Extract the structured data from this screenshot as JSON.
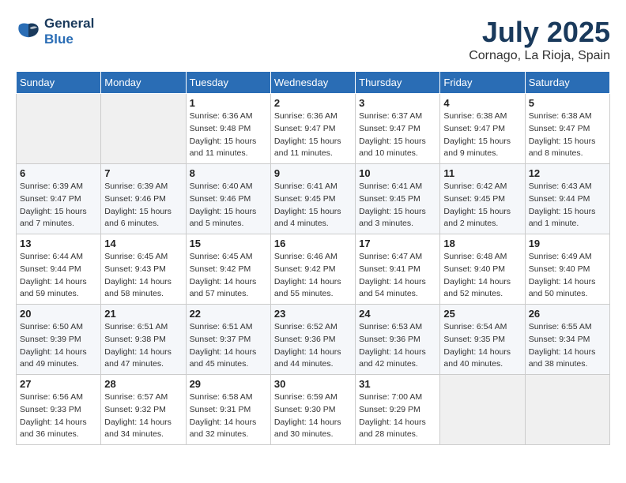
{
  "logo": {
    "line1": "General",
    "line2": "Blue"
  },
  "title": "July 2025",
  "location": "Cornago, La Rioja, Spain",
  "weekdays": [
    "Sunday",
    "Monday",
    "Tuesday",
    "Wednesday",
    "Thursday",
    "Friday",
    "Saturday"
  ],
  "weeks": [
    [
      {
        "day": "",
        "sunrise": "",
        "sunset": "",
        "daylight": ""
      },
      {
        "day": "",
        "sunrise": "",
        "sunset": "",
        "daylight": ""
      },
      {
        "day": "1",
        "sunrise": "Sunrise: 6:36 AM",
        "sunset": "Sunset: 9:48 PM",
        "daylight": "Daylight: 15 hours and 11 minutes."
      },
      {
        "day": "2",
        "sunrise": "Sunrise: 6:36 AM",
        "sunset": "Sunset: 9:47 PM",
        "daylight": "Daylight: 15 hours and 11 minutes."
      },
      {
        "day": "3",
        "sunrise": "Sunrise: 6:37 AM",
        "sunset": "Sunset: 9:47 PM",
        "daylight": "Daylight: 15 hours and 10 minutes."
      },
      {
        "day": "4",
        "sunrise": "Sunrise: 6:38 AM",
        "sunset": "Sunset: 9:47 PM",
        "daylight": "Daylight: 15 hours and 9 minutes."
      },
      {
        "day": "5",
        "sunrise": "Sunrise: 6:38 AM",
        "sunset": "Sunset: 9:47 PM",
        "daylight": "Daylight: 15 hours and 8 minutes."
      }
    ],
    [
      {
        "day": "6",
        "sunrise": "Sunrise: 6:39 AM",
        "sunset": "Sunset: 9:47 PM",
        "daylight": "Daylight: 15 hours and 7 minutes."
      },
      {
        "day": "7",
        "sunrise": "Sunrise: 6:39 AM",
        "sunset": "Sunset: 9:46 PM",
        "daylight": "Daylight: 15 hours and 6 minutes."
      },
      {
        "day": "8",
        "sunrise": "Sunrise: 6:40 AM",
        "sunset": "Sunset: 9:46 PM",
        "daylight": "Daylight: 15 hours and 5 minutes."
      },
      {
        "day": "9",
        "sunrise": "Sunrise: 6:41 AM",
        "sunset": "Sunset: 9:45 PM",
        "daylight": "Daylight: 15 hours and 4 minutes."
      },
      {
        "day": "10",
        "sunrise": "Sunrise: 6:41 AM",
        "sunset": "Sunset: 9:45 PM",
        "daylight": "Daylight: 15 hours and 3 minutes."
      },
      {
        "day": "11",
        "sunrise": "Sunrise: 6:42 AM",
        "sunset": "Sunset: 9:45 PM",
        "daylight": "Daylight: 15 hours and 2 minutes."
      },
      {
        "day": "12",
        "sunrise": "Sunrise: 6:43 AM",
        "sunset": "Sunset: 9:44 PM",
        "daylight": "Daylight: 15 hours and 1 minute."
      }
    ],
    [
      {
        "day": "13",
        "sunrise": "Sunrise: 6:44 AM",
        "sunset": "Sunset: 9:44 PM",
        "daylight": "Daylight: 14 hours and 59 minutes."
      },
      {
        "day": "14",
        "sunrise": "Sunrise: 6:45 AM",
        "sunset": "Sunset: 9:43 PM",
        "daylight": "Daylight: 14 hours and 58 minutes."
      },
      {
        "day": "15",
        "sunrise": "Sunrise: 6:45 AM",
        "sunset": "Sunset: 9:42 PM",
        "daylight": "Daylight: 14 hours and 57 minutes."
      },
      {
        "day": "16",
        "sunrise": "Sunrise: 6:46 AM",
        "sunset": "Sunset: 9:42 PM",
        "daylight": "Daylight: 14 hours and 55 minutes."
      },
      {
        "day": "17",
        "sunrise": "Sunrise: 6:47 AM",
        "sunset": "Sunset: 9:41 PM",
        "daylight": "Daylight: 14 hours and 54 minutes."
      },
      {
        "day": "18",
        "sunrise": "Sunrise: 6:48 AM",
        "sunset": "Sunset: 9:40 PM",
        "daylight": "Daylight: 14 hours and 52 minutes."
      },
      {
        "day": "19",
        "sunrise": "Sunrise: 6:49 AM",
        "sunset": "Sunset: 9:40 PM",
        "daylight": "Daylight: 14 hours and 50 minutes."
      }
    ],
    [
      {
        "day": "20",
        "sunrise": "Sunrise: 6:50 AM",
        "sunset": "Sunset: 9:39 PM",
        "daylight": "Daylight: 14 hours and 49 minutes."
      },
      {
        "day": "21",
        "sunrise": "Sunrise: 6:51 AM",
        "sunset": "Sunset: 9:38 PM",
        "daylight": "Daylight: 14 hours and 47 minutes."
      },
      {
        "day": "22",
        "sunrise": "Sunrise: 6:51 AM",
        "sunset": "Sunset: 9:37 PM",
        "daylight": "Daylight: 14 hours and 45 minutes."
      },
      {
        "day": "23",
        "sunrise": "Sunrise: 6:52 AM",
        "sunset": "Sunset: 9:36 PM",
        "daylight": "Daylight: 14 hours and 44 minutes."
      },
      {
        "day": "24",
        "sunrise": "Sunrise: 6:53 AM",
        "sunset": "Sunset: 9:36 PM",
        "daylight": "Daylight: 14 hours and 42 minutes."
      },
      {
        "day": "25",
        "sunrise": "Sunrise: 6:54 AM",
        "sunset": "Sunset: 9:35 PM",
        "daylight": "Daylight: 14 hours and 40 minutes."
      },
      {
        "day": "26",
        "sunrise": "Sunrise: 6:55 AM",
        "sunset": "Sunset: 9:34 PM",
        "daylight": "Daylight: 14 hours and 38 minutes."
      }
    ],
    [
      {
        "day": "27",
        "sunrise": "Sunrise: 6:56 AM",
        "sunset": "Sunset: 9:33 PM",
        "daylight": "Daylight: 14 hours and 36 minutes."
      },
      {
        "day": "28",
        "sunrise": "Sunrise: 6:57 AM",
        "sunset": "Sunset: 9:32 PM",
        "daylight": "Daylight: 14 hours and 34 minutes."
      },
      {
        "day": "29",
        "sunrise": "Sunrise: 6:58 AM",
        "sunset": "Sunset: 9:31 PM",
        "daylight": "Daylight: 14 hours and 32 minutes."
      },
      {
        "day": "30",
        "sunrise": "Sunrise: 6:59 AM",
        "sunset": "Sunset: 9:30 PM",
        "daylight": "Daylight: 14 hours and 30 minutes."
      },
      {
        "day": "31",
        "sunrise": "Sunrise: 7:00 AM",
        "sunset": "Sunset: 9:29 PM",
        "daylight": "Daylight: 14 hours and 28 minutes."
      },
      {
        "day": "",
        "sunrise": "",
        "sunset": "",
        "daylight": ""
      },
      {
        "day": "",
        "sunrise": "",
        "sunset": "",
        "daylight": ""
      }
    ]
  ]
}
